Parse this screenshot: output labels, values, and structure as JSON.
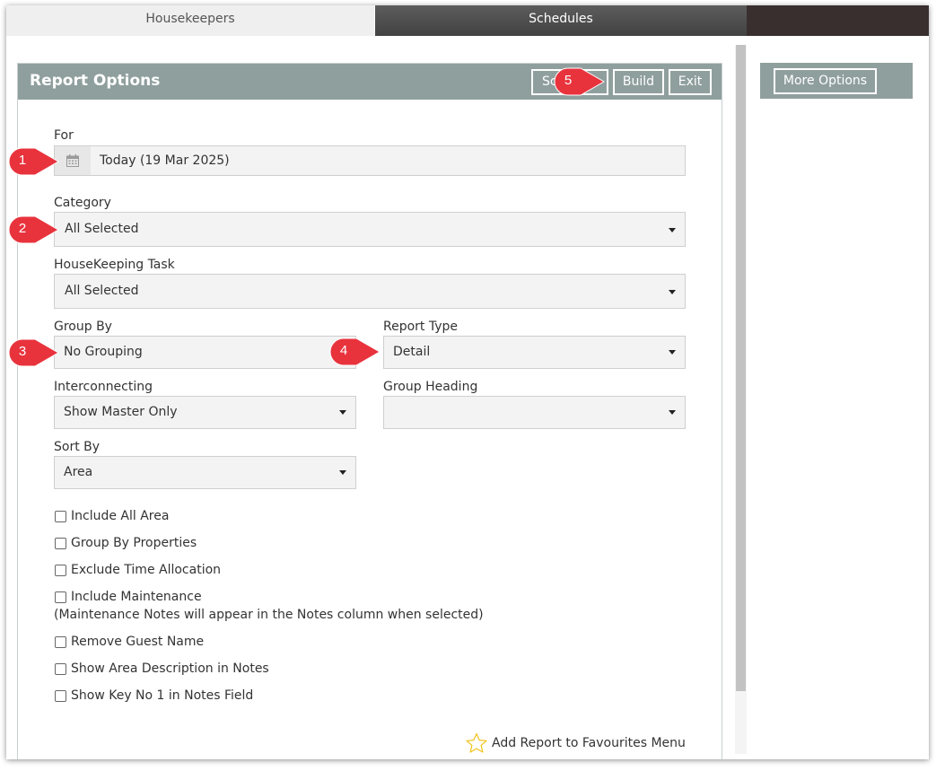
{
  "tabs": [
    {
      "label": "Housekeepers",
      "active": false
    },
    {
      "label": "Schedules",
      "active": true
    }
  ],
  "panel": {
    "title": "Report Options",
    "buttons": {
      "schedule": "Schedule",
      "build": "Build",
      "exit": "Exit"
    }
  },
  "more_options": {
    "label": "More Options"
  },
  "form": {
    "for": {
      "label": "For",
      "value": "Today (19 Mar 2025)",
      "icon": "calendar-icon"
    },
    "category": {
      "label": "Category",
      "value": "All Selected"
    },
    "housekeeping_task": {
      "label": "HouseKeeping Task",
      "value": "All Selected"
    },
    "group_by": {
      "label": "Group By",
      "value": "No Grouping"
    },
    "report_type": {
      "label": "Report Type",
      "value": "Detail"
    },
    "interconnecting": {
      "label": "Interconnecting",
      "value": "Show Master Only"
    },
    "group_heading": {
      "label": "Group Heading",
      "value": ""
    },
    "sort_by": {
      "label": "Sort By",
      "value": "Area"
    }
  },
  "checkboxes": [
    {
      "label": "Include All Area",
      "checked": false
    },
    {
      "label": "Group By Properties",
      "checked": false
    },
    {
      "label": "Exclude Time Allocation",
      "checked": false
    },
    {
      "label": "Include Maintenance",
      "checked": false
    },
    {
      "label": "Remove Guest Name",
      "checked": false
    },
    {
      "label": "Show Area Description in Notes",
      "checked": false
    },
    {
      "label": "Show Key No 1 in Notes Field",
      "checked": false
    }
  ],
  "maintenance_note": "(Maintenance Notes will appear in the Notes column when selected)",
  "favourites": {
    "label": "Add Report to Favourites Menu",
    "icon": "star-outline-icon"
  },
  "markers": [
    "1",
    "2",
    "3",
    "4",
    "5"
  ],
  "colors": {
    "header": "#8f9f9e",
    "active_tab": "#4a4a4a",
    "marker_red": "#e8333d",
    "star": "#f0c419"
  }
}
